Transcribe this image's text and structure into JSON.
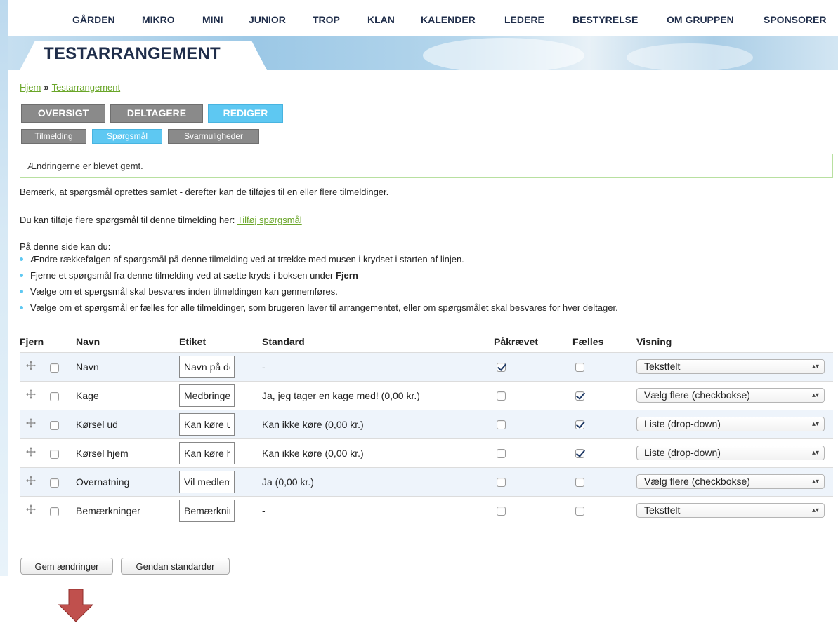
{
  "nav": [
    "GÅRDEN",
    "MIKRO",
    "MINI",
    "JUNIOR",
    "TROP",
    "KLAN",
    "KALENDER",
    "LEDERE",
    "BESTYRELSE",
    "OM GRUPPEN",
    "SPONSORER"
  ],
  "page_title": "TESTARRANGEMENT",
  "breadcrumb": {
    "home": "Hjem",
    "separator": "»",
    "current": "Testarrangement"
  },
  "tabs_primary": [
    {
      "label": "OVERSIGT",
      "active": false
    },
    {
      "label": "DELTAGERE",
      "active": false
    },
    {
      "label": "REDIGER",
      "active": true
    }
  ],
  "tabs_secondary": [
    {
      "label": "Tilmelding",
      "active": false
    },
    {
      "label": "Spørgsmål",
      "active": true
    },
    {
      "label": "Svarmuligheder",
      "active": false
    }
  ],
  "status_message": "Ændringerne er blevet gemt.",
  "intro1": "Bemærk, at spørgsmål oprettes samlet - derefter kan de tilføjes til en eller flere tilmeldinger.",
  "intro2_text": "Du kan tilføje flere spørgsmål til denne tilmelding her: ",
  "intro2_link": "Tilføj spørgsmål",
  "intro3": "På denne side kan du:",
  "bullets": {
    "b1": "Ændre rækkefølgen af spørgsmål på denne tilmelding ved at trække med musen i krydset i starten af linjen.",
    "b2_prefix": "Fjerne et spørgsmål fra denne tilmelding ved at sætte kryds i boksen under ",
    "b2_bold": "Fjern",
    "b3": "Vælge om et spørgsmål skal besvares inden tilmeldingen kan gennemføres.",
    "b4": "Vælge om et spørgsmål er fælles for alle tilmeldinger, som brugeren laver til arrangementet, eller om spørgsmålet skal besvares for hver deltager."
  },
  "table": {
    "headers": {
      "remove": "Fjern",
      "name": "Navn",
      "label": "Etiket",
      "default": "Standard",
      "required": "Påkrævet",
      "shared": "Fælles",
      "display": "Visning"
    },
    "rows": [
      {
        "name": "Navn",
        "label": "Navn på deltager",
        "default": "-",
        "required": true,
        "shared": false,
        "display": "Tekstfelt"
      },
      {
        "name": "Kage",
        "label": "Medbringer du kage?",
        "default": "Ja, jeg tager en kage med! (0,00 kr.)",
        "required": false,
        "shared": true,
        "display": "Vælg flere (checkbokse)"
      },
      {
        "name": "Kørsel ud",
        "label": "Kan køre ud?",
        "default": "Kan ikke køre (0,00 kr.)",
        "required": false,
        "shared": true,
        "display": "Liste (drop-down)"
      },
      {
        "name": "Kørsel hjem",
        "label": "Kan køre hjem?",
        "default": "Kan ikke køre (0,00 kr.)",
        "required": false,
        "shared": true,
        "display": "Liste (drop-down)"
      },
      {
        "name": "Overnatning",
        "label": "Vil medlemmet overnatte?",
        "default": "Ja (0,00 kr.)",
        "required": false,
        "shared": false,
        "display": "Vælg flere (checkbokse)"
      },
      {
        "name": "Bemærkninger",
        "label": "Bemærkninger",
        "default": "-",
        "required": false,
        "shared": false,
        "display": "Tekstfelt"
      }
    ]
  },
  "buttons": {
    "save": "Gem ændringer",
    "reset": "Gendan standarder"
  },
  "colors": {
    "accent": "#5ec8f2",
    "link": "#6aa629",
    "nav_text": "#1f2d4a",
    "arrow": "#c0504d"
  },
  "icons": {
    "drag": "move-cross-icon",
    "select": "updown-arrows-icon",
    "pointer": "down-arrow-icon"
  }
}
